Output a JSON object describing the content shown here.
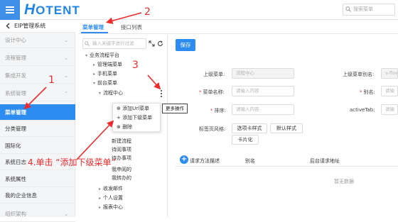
{
  "header": {
    "logo_text": "OTENT",
    "logo_letter": "H",
    "search_placeholder": "搜索菜单"
  },
  "sidebar": {
    "title": "EIP管理系统",
    "items": [
      {
        "label": "设计中心",
        "has_children": true
      },
      {
        "label": "流程管理",
        "has_children": true
      },
      {
        "label": "集成开发",
        "has_children": true
      },
      {
        "label": "系统管理",
        "has_children": true
      },
      {
        "label": "菜单管理",
        "active": true
      },
      {
        "label": "分类管理"
      },
      {
        "label": "国际化"
      },
      {
        "label": "系统日志"
      },
      {
        "label": "系统属性"
      },
      {
        "label": "我的企业信息"
      },
      {
        "label": "组织架构"
      }
    ]
  },
  "tabs": [
    {
      "label": "菜单管理",
      "active": true
    },
    {
      "label": "接口列表",
      "active": false
    }
  ],
  "tree": {
    "search_placeholder": "输入关键字进行过滤",
    "nodes": [
      "业务流程平台",
      "管理端菜单",
      "手机菜单",
      "前台菜单",
      "流程中心",
      "新建流程",
      "待阅事项",
      "待办事项",
      "我申阅的",
      "我转办的",
      "收发邮件",
      "个人设置",
      "报表中心"
    ]
  },
  "context_menu": {
    "items": [
      "添加Url菜单",
      "添加下级菜单",
      "删除"
    ],
    "tooltip": "更多操作"
  },
  "toolbar": {
    "save_label": "保存"
  },
  "form": {
    "parent_menu_label": "上级菜单:",
    "parent_menu_value": "流程中心",
    "parent_alias_label": "上级菜单别名:",
    "parent_alias_value": "v-flow",
    "name_label": "菜单名称:",
    "name_placeholder": "请输入内容",
    "alias_label": "别名:",
    "alias_placeholder": "请输",
    "sort_label": "排序:",
    "sort_placeholder": "请输入内容",
    "active_tab_label": "activeTab:",
    "active_tab_placeholder": "请输",
    "tab_style_label": "标签页风格:",
    "tab_style_options": [
      "选项卡样式",
      "默认样式",
      "卡片化"
    ]
  },
  "table": {
    "add_label": "+",
    "columns": [
      "请求方法描述",
      "别名",
      "后台请求地址"
    ],
    "empty_text": "暂无数据"
  },
  "annotations": {
    "num1": "1",
    "num2": "2",
    "num3": "3",
    "step4": "4.单击 “添加下级菜单”"
  },
  "colors": {
    "accent": "#2d8cf0",
    "annotation": "#f0292b"
  }
}
